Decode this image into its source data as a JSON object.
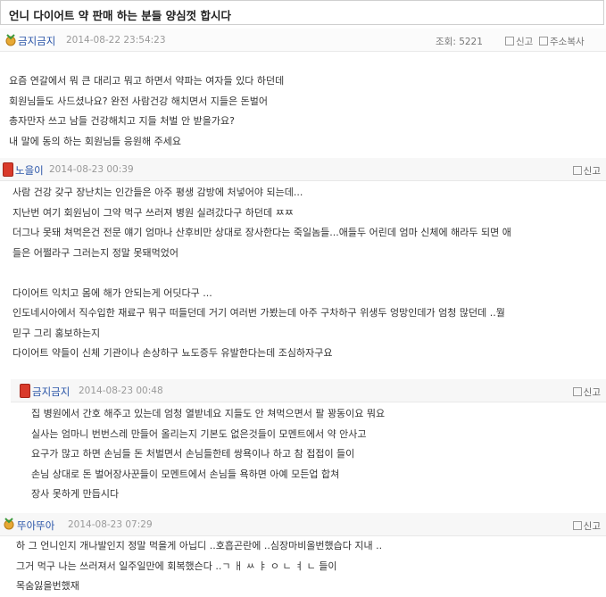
{
  "post": {
    "title": "언니 다이어트 약 판매 하는 분들 양심껏 합시다",
    "author": "금지금지",
    "date": "2014-08-22 23:54:23",
    "views_label": "조회: 5221",
    "report_label": "신고",
    "copy_label": "주소복사",
    "body": [
      "요즘 연갈에서 뭐 큰 대리고 뭐고 하면서 약파는 여자들 있다 하던데",
      "회원님들도 사드셨나요? 완전 사람건강 해치면서 지들은 돈벌어",
      "총자만자 쓰고 남들 건강해치고 지들 처벌 안 받을가요?",
      "내 말에 동의 하는 회원님들 응원해 주세요"
    ]
  },
  "comments": [
    {
      "author": "노을이",
      "date": "2014-08-23 00:39",
      "report_label": "신고",
      "icon": "red-badge-icon",
      "body": [
        "사람 건강 갖구 장난치는 인간들은 아주 평생 감방에 처넣어야 되는데...",
        "지난번 여기 회원님이 그약 먹구 쓰러져 병원 실려갔다구 하던데 ㅉㅉ",
        "더그나 못돼 쳐먹은건 전문 얘기 엄마나 산후비만 상대로 장사한다는 죽일놈들...애들두 어린데 엄마 신체에 해라두 되면 애",
        "들은 어쩔라구 그러는지 정말 못돼먹었어",
        "",
        "다이어트 익치고 몸에 해가 안되는게 어딧다구 ...",
        "인도네시아에서 직수입한 재료구 뭐구 떠들던데 거기 여러번 가봤는데 아주 구차하구 위생두 엉망인데가 엄청 많던데 ..뭘",
        "믿구 그리 홍보하는지",
        "다이어트 약들이 신체 기관이나 손상하구 뇨도증두 유발한다는데 조심하자구요"
      ]
    },
    {
      "author": "금지금지",
      "date": "2014-08-23 00:48",
      "report_label": "신고",
      "icon": "red-badge-icon",
      "body": [
        "집 병원에서 간호 해주고 있는데 엄청 열받네요 지들도 안 쳐먹으면서 팔 꽝동이요 뭐요",
        "실사는 엄마니 번번스레 만들어 올리는지 기본도 없은것들이 모멘트에서 약 안사고",
        "요구가 많고 하면 손님들 돈 처벌면서 손님들한테 쌍욕이나 하고 참 접접이 들이",
        "손님 상대로 돈 벌어장사꾼들이 모멘트에서 손님들 욕하면 아예 모든업 합쳐",
        "장사 못하게 만듭시다"
      ]
    },
    {
      "author": "뚜아뚜아",
      "date": "2014-08-23 07:29",
      "report_label": "신고",
      "icon": "medal-icon",
      "body": [
        "하 그 언니인지 개나발인지 정말 먹을게 아닙디 ..호흡곤란에 ..심장마비올번했습다 지내 ..",
        "그거 먹구 나는 쓰러져서 일주일만에 회복했슨다 ..ㄱ ㅐ ㅆ ㅑ ㅇ ㄴ ㅕ ㄴ 들이",
        "목숨잃을번했재"
      ]
    }
  ]
}
